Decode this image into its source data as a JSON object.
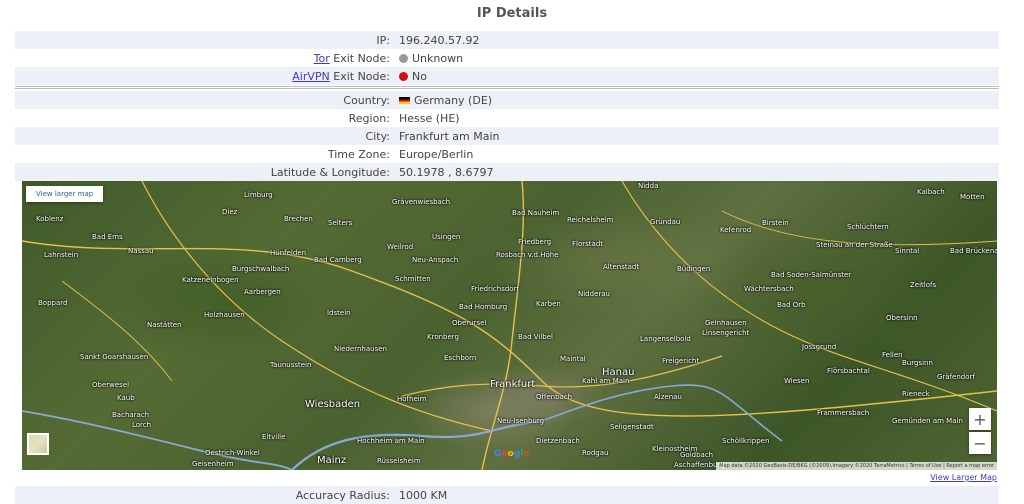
{
  "title": "IP Details",
  "rows_top": [
    {
      "label": "IP:",
      "value": "196.240.57.92"
    },
    {
      "link": "Tor",
      "label": " Exit Node:",
      "value": "Unknown",
      "dot": "#9a9a9a"
    },
    {
      "link": "AirVPN",
      "label": " Exit Node:",
      "value": "No",
      "dot": "#cc1111"
    }
  ],
  "rows_geo": [
    {
      "label": "Country:",
      "value": "Germany (DE)",
      "flag": "de-flag-icon"
    },
    {
      "label": "Region:",
      "value": "Hesse (HE)"
    },
    {
      "label": "City:",
      "value": "Frankfurt am Main"
    },
    {
      "label": "Time Zone:",
      "value": "Europe/Berlin"
    },
    {
      "label": "Latitude & Longitude:",
      "value": "50.1978 , 8.6797"
    }
  ],
  "map": {
    "view_larger_button": "View larger map",
    "zoom_in": "+",
    "zoom_out": "−",
    "google_logo": [
      "G",
      "o",
      "o",
      "g",
      "l",
      "e"
    ],
    "attribution": "Map data ©2020 GeoBasis-DE/BKG (©2009),Imagery ©2020 TerraMetrics | Terms of Use | Report a map error",
    "places": [
      "Koblenz",
      "Bad Ems",
      "Limburg",
      "Diez",
      "Nassau",
      "Lahnstein",
      "Katzenelnbogen",
      "Boppard",
      "Bad Camberg",
      "Idstein",
      "Usingen",
      "Weilrod",
      "Bad Nauheim",
      "Friedberg",
      "Reichelsheim",
      "Gründau",
      "Kefenrod",
      "Birstein",
      "Schlüchtern",
      "Büdingen",
      "Bad Homburg",
      "Oberursel",
      "Bad Vilbel",
      "Maintal",
      "Hanau",
      "Langenselbold",
      "Gelnhausen",
      "Bad Orb",
      "Wächtersbach",
      "Niedernhausen",
      "Taunusstein",
      "Eschborn",
      "Offenbach",
      "Wiesbaden",
      "Mainz",
      "Rüsselsheim",
      "Hochheim am Main",
      "Neu-Isenburg",
      "Dietzenbach",
      "Seligenstadt",
      "Rodgau",
      "Aschaffenburg",
      "Alzenau",
      "Frammersbach",
      "Wiesen",
      "Flörsbachtal",
      "Rieneck",
      "Gemünden am Main",
      "Obersinn",
      "Jossgrund",
      "Eltville",
      "Oestrich-Winkel",
      "Geisenheim",
      "Lorch",
      "Bacharach",
      "Kaub",
      "Oberwesel",
      "Sankt Goarshausen",
      "Nastätten",
      "Holzhausen",
      "Aarbergen",
      "Burgschwalbach",
      "Hünfelden",
      "Brechen",
      "Selters",
      "Karben",
      "Nidderau",
      "Altenstadt",
      "Florstadt",
      "Rosbach v.d.Höhe",
      "Friedrichsdorf",
      "Kronberg",
      "Hofheim",
      "Grävenwiesbach",
      "Neu-Anspach",
      "Schmitten",
      "Steinau an der Straße",
      "Sinntal",
      "Bad Brückenau",
      "Zeitlofs",
      "Bad Soden-Salmünster",
      "Linsengericht",
      "Freigericht",
      "Kahl am Main",
      "Goldbach",
      "Kleinostheim",
      "Schöllkrippen",
      "Fellen",
      "Burgsinn",
      "Gräfendorf",
      "Nidda",
      "Kalbach",
      "Motten",
      "Frankfurt"
    ]
  },
  "footer_link": "View Larger Map",
  "rows_bottom": [
    {
      "label": "Accuracy Radius:",
      "value": "1000 KM"
    }
  ]
}
